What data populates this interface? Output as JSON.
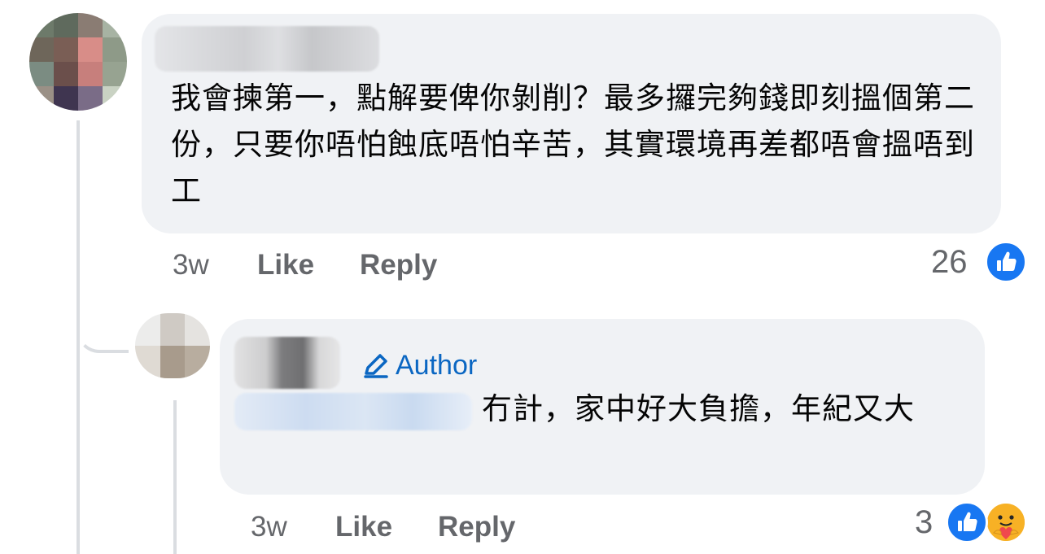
{
  "comment1": {
    "text": "我會揀第一，點解要俾你剝削？最多攞完夠錢即刻搵個第二份，只要你唔怕蝕底唔怕辛苦，其實環境再差都唔會搵唔到工",
    "time": "3w",
    "like_label": "Like",
    "reply_label": "Reply",
    "reaction_count": "26",
    "reaction_icon": "thumbs-up-icon"
  },
  "reply1": {
    "author_badge": "Author",
    "text": "冇計，家中好大負擔，年紀又大",
    "time": "3w",
    "like_label": "Like",
    "reply_label": "Reply",
    "reaction_count": "3",
    "reaction_icons": [
      "thumbs-up-icon",
      "care-icon"
    ]
  },
  "colors": {
    "bubble": "#f0f2f5",
    "meta": "#65676b",
    "like_blue": "#1877f2",
    "author_blue": "#0a66c2"
  }
}
